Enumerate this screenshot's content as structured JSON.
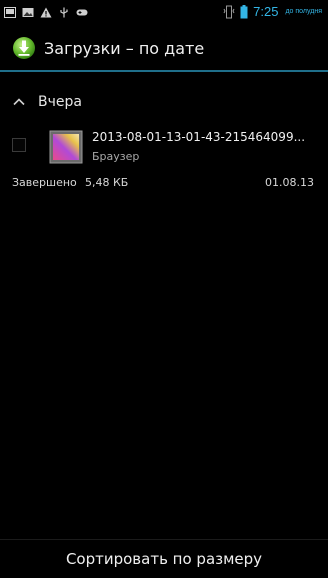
{
  "status_bar": {
    "time": "7:25",
    "ampm": "до полудня",
    "icons": [
      "screenshot-icon",
      "photo-icon",
      "warning-icon",
      "usb-icon",
      "gamepad-icon",
      "vibrate-icon",
      "battery-icon"
    ]
  },
  "action_bar": {
    "title": "Загрузки – по дате",
    "icon": "download-icon"
  },
  "section": {
    "title": "Вчера",
    "collapse_icon": "chevron-up-icon"
  },
  "items": [
    {
      "filename": "2013-08-01-13-01-43-215464099...",
      "source": "Браузер",
      "status": "Завершено",
      "size": "5,48 КБ",
      "date": "01.08.13"
    }
  ],
  "bottom_bar": {
    "sort_label": "Сортировать по размеру"
  },
  "colors": {
    "accent": "#33b5e5",
    "divider": "#1f6f8b",
    "background": "#000000"
  }
}
